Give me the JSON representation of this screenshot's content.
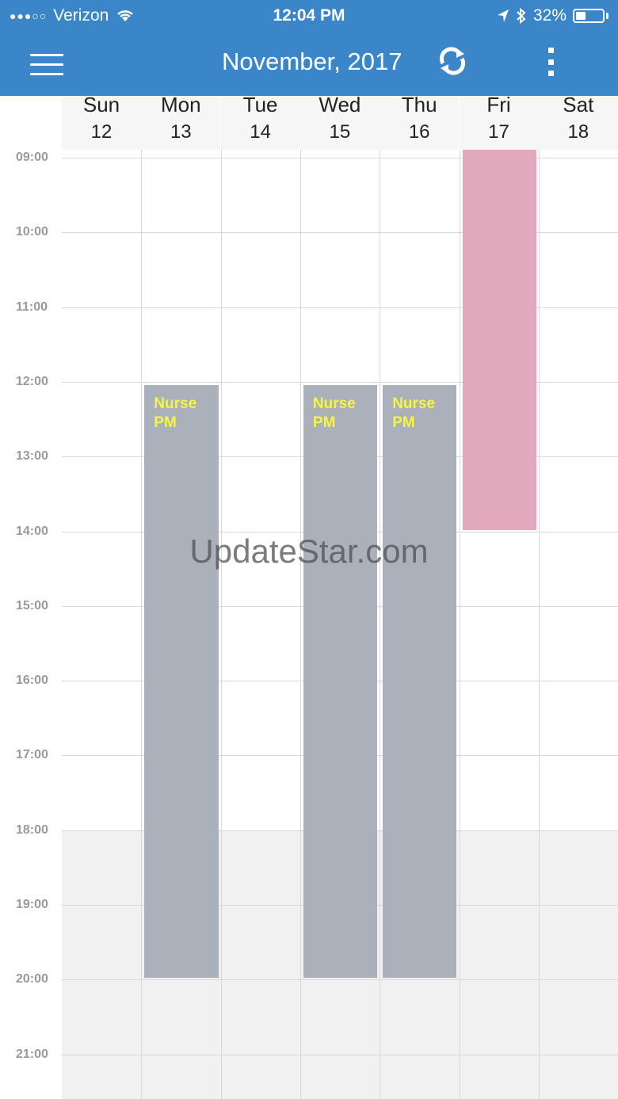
{
  "status_bar": {
    "carrier": "Verizon",
    "time": "12:04 PM",
    "battery": "32%",
    "battery_level": 0.32
  },
  "app_bar": {
    "title": "November, 2017",
    "menu_icon": "hamburger-menu-icon",
    "sync_icon": "sync-icon",
    "more_icon": "more-vertical-icon"
  },
  "days": [
    {
      "name": "Sun",
      "num": "12"
    },
    {
      "name": "Mon",
      "num": "13"
    },
    {
      "name": "Tue",
      "num": "14"
    },
    {
      "name": "Wed",
      "num": "15"
    },
    {
      "name": "Thu",
      "num": "16"
    },
    {
      "name": "Fri",
      "num": "17"
    },
    {
      "name": "Sat",
      "num": "18"
    }
  ],
  "hours": [
    "09:00",
    "10:00",
    "11:00",
    "12:00",
    "13:00",
    "14:00",
    "15:00",
    "16:00",
    "17:00",
    "18:00",
    "19:00",
    "20:00",
    "21:00"
  ],
  "events": [
    {
      "day": 1,
      "title": "Nurse PM",
      "line1": "Nurse",
      "line2": "PM",
      "start": "12:00",
      "end": "20:00",
      "color": "#aab1bb"
    },
    {
      "day": 3,
      "title": "Nurse PM",
      "line1": "Nurse",
      "line2": "PM",
      "start": "12:00",
      "end": "20:00",
      "color": "#aab1bb"
    },
    {
      "day": 4,
      "title": "Nurse PM",
      "line1": "Nurse",
      "line2": "PM",
      "start": "12:00",
      "end": "20:00",
      "color": "#aab1bb"
    },
    {
      "day": 5,
      "title": "",
      "line1": "",
      "line2": "",
      "start": "09:00",
      "end": "14:00",
      "color": "#e2a9bc"
    }
  ],
  "watermark": "UpdateStar.com",
  "colors": {
    "header": "#3a86c8",
    "event_text": "#f7f542"
  }
}
